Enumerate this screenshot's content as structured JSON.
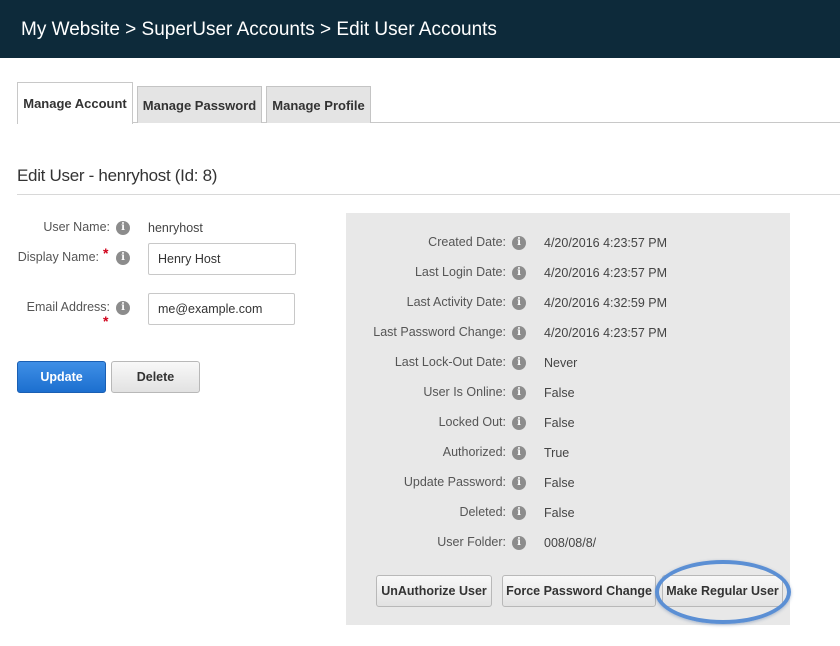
{
  "header": {
    "breadcrumb": "My Website > SuperUser Accounts > Edit User Accounts"
  },
  "tabs": [
    {
      "label": "Manage Account",
      "active": true
    },
    {
      "label": "Manage Password",
      "active": false
    },
    {
      "label": "Manage Profile",
      "active": false
    }
  ],
  "section": {
    "title": "Edit User - henryhost (Id: 8)"
  },
  "form": {
    "user_name_label": "User Name:",
    "user_name_value": "henryhost",
    "display_name_label": "Display Name:",
    "display_name_value": "Henry Host",
    "email_label": "Email Address:",
    "email_value": "me@example.com",
    "required_mark": "*",
    "info_glyph": "i"
  },
  "actions": {
    "update_label": "Update",
    "delete_label": "Delete"
  },
  "details": [
    {
      "label": "Created Date:",
      "value": "4/20/2016 4:23:57 PM"
    },
    {
      "label": "Last Login Date:",
      "value": "4/20/2016 4:23:57 PM"
    },
    {
      "label": "Last Activity Date:",
      "value": "4/20/2016 4:32:59 PM"
    },
    {
      "label": "Last Password Change:",
      "value": "4/20/2016 4:23:57 PM"
    },
    {
      "label": "Last Lock-Out Date:",
      "value": "Never"
    },
    {
      "label": "User Is Online:",
      "value": "False"
    },
    {
      "label": "Locked Out:",
      "value": "False"
    },
    {
      "label": "Authorized:",
      "value": "True"
    },
    {
      "label": "Update Password:",
      "value": "False"
    },
    {
      "label": "Deleted:",
      "value": "False"
    },
    {
      "label": "User Folder:",
      "value": "008/08/8/"
    }
  ],
  "panel_actions": {
    "unauthorize_label": "UnAuthorize User",
    "force_password_label": "Force Password Change",
    "make_regular_label": "Make Regular User"
  },
  "colors": {
    "header_bg": "#0d2a3a",
    "primary_button": "#1c6fcf",
    "highlight_ring": "#5b8fd4",
    "required": "#d0021b"
  }
}
